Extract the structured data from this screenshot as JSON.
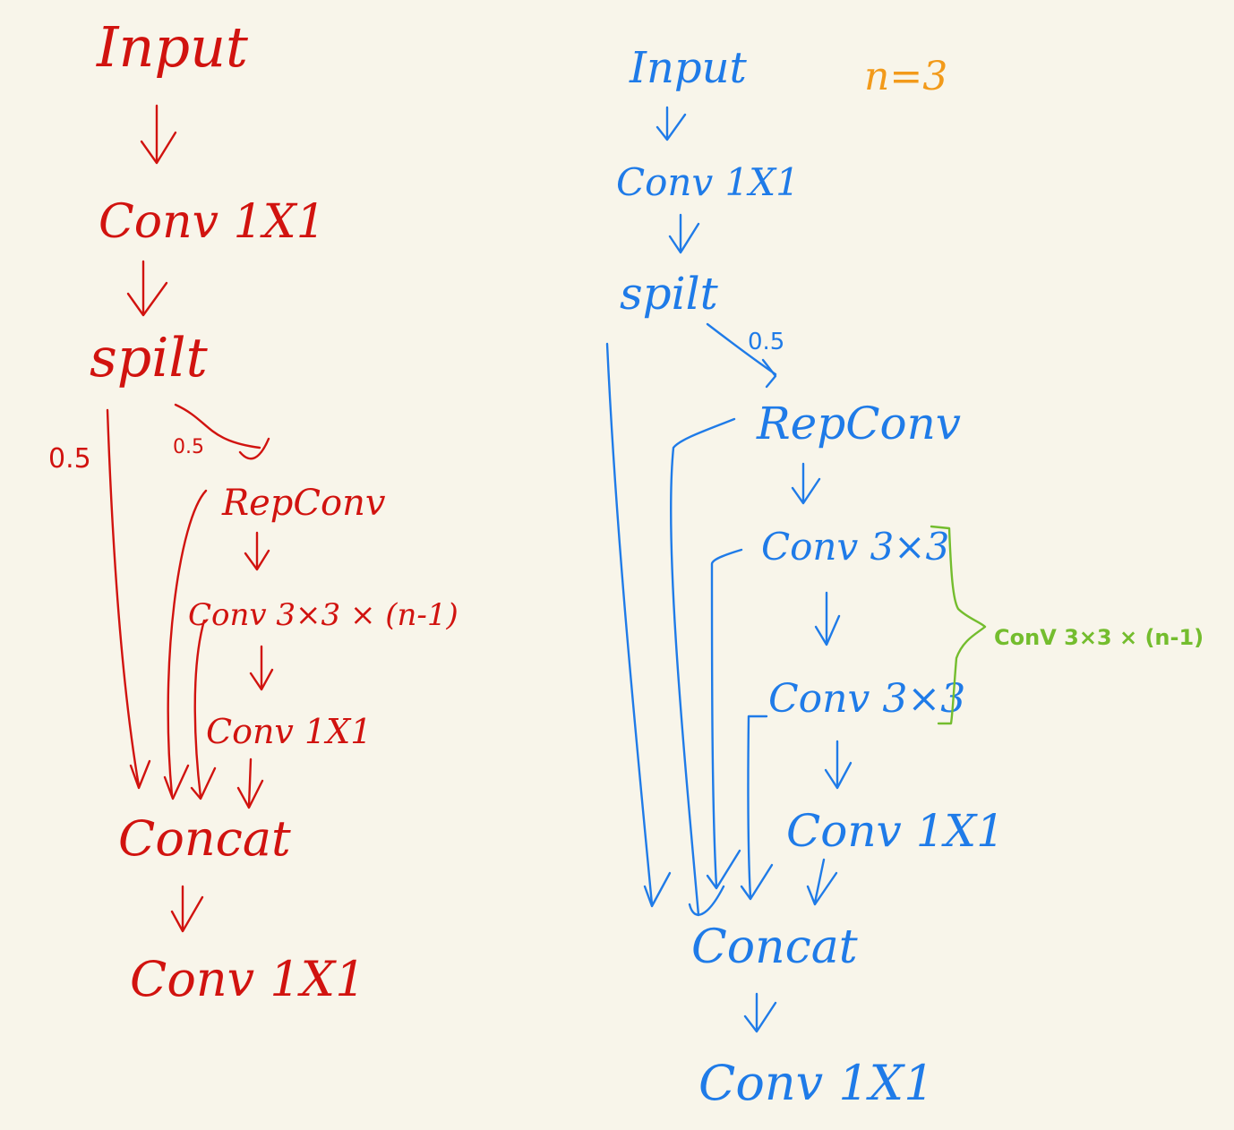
{
  "left": {
    "color": "#d1130f",
    "input": "Input",
    "conv_first": "Conv 1X1",
    "split": "spilt",
    "ratio_a": "0.5",
    "ratio_b": "0.5",
    "repconv": "RepConv",
    "conv3": "Conv 3×3 × (n-1)",
    "conv_mid": "Conv 1X1",
    "concat": "Concat",
    "conv_last": "Conv 1X1"
  },
  "right": {
    "color": "#1f7be8",
    "n_label": "n=3",
    "n_color": "#f29a1a",
    "input": "Input",
    "conv_first": "Conv 1X1",
    "split": "spilt",
    "ratio": "0.5",
    "repconv": "RepConv",
    "conv3_a": "Conv 3×3",
    "conv3_b": "Conv 3×3",
    "brace_label": "ConV 3×3 × (n-1)",
    "brace_color": "#74bd2e",
    "conv_mid": "Conv 1X1",
    "concat": "Concat",
    "conv_last": "Conv 1X1"
  }
}
